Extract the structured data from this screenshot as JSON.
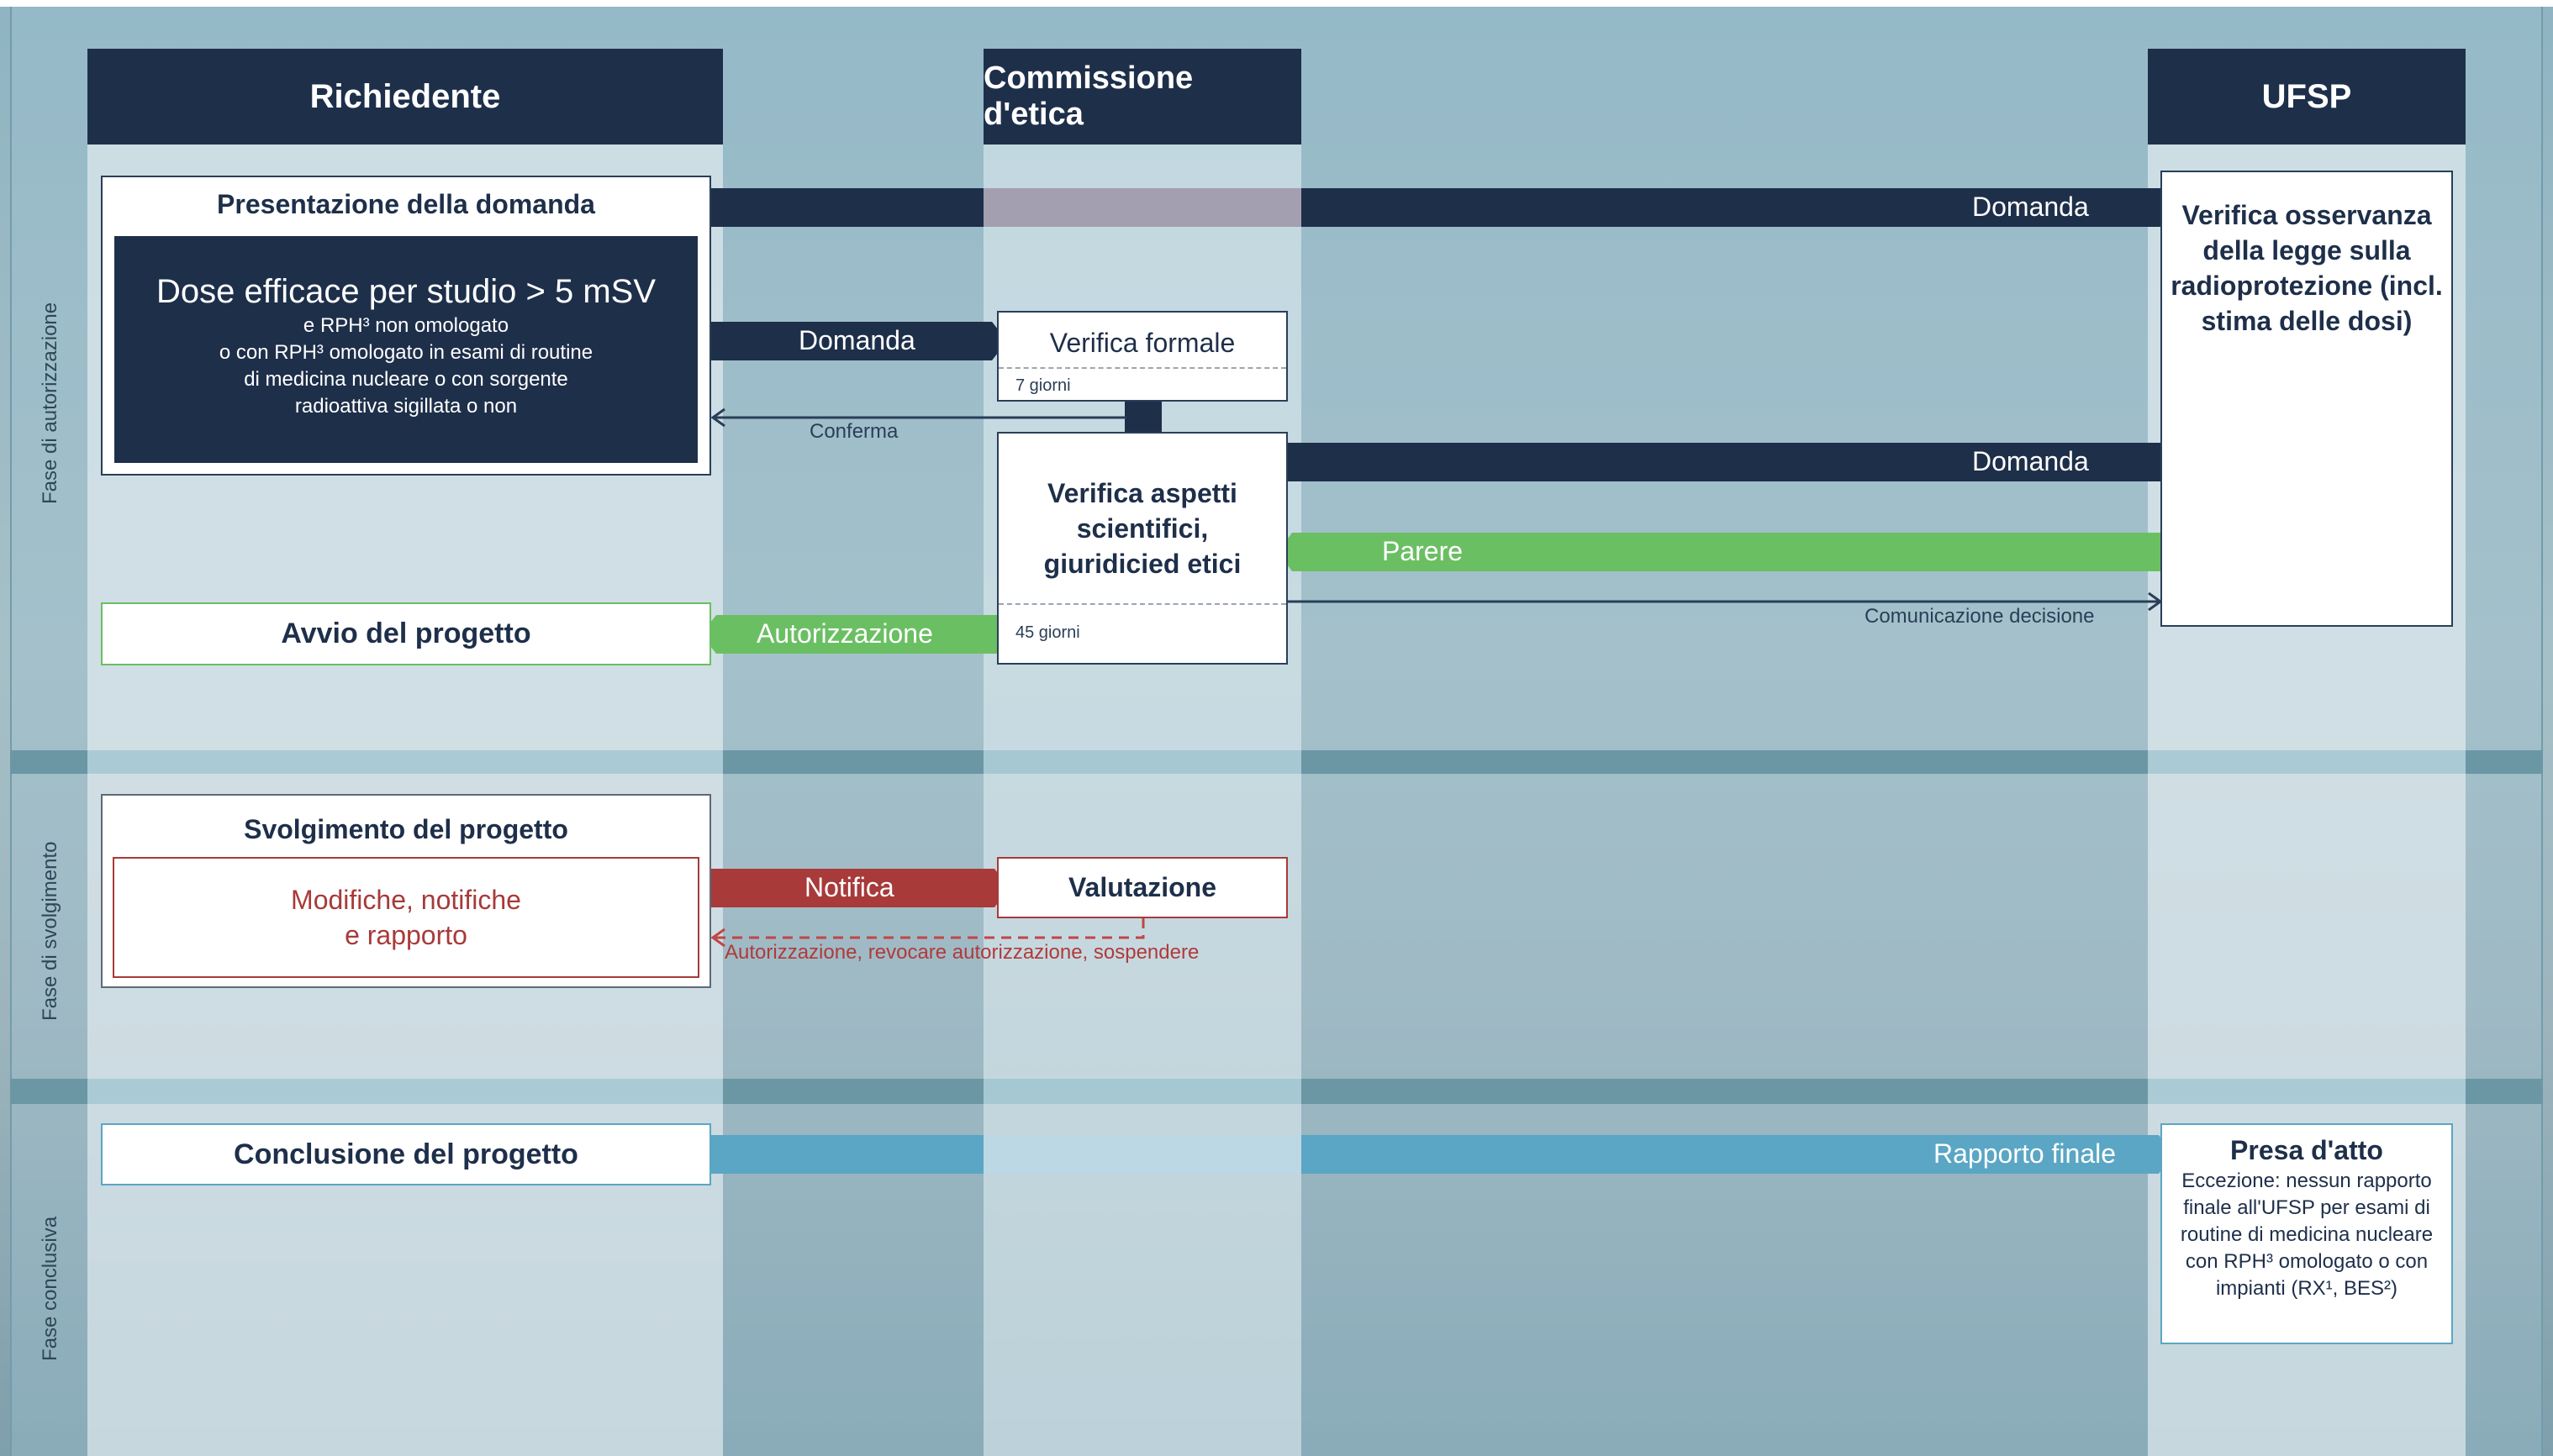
{
  "lanes": {
    "applicant": "Richiedente",
    "ethics": "Commissione d'etica",
    "ufsp": "UFSP"
  },
  "phases": {
    "authorization": "Fase di autorizzazione",
    "execution": "Fase di svolgimento",
    "conclusion": "Fase conclusiva"
  },
  "authorization": {
    "submission_title": "Presentazione della domanda",
    "dose_title": "Dose efficace per studio > 5 mSV",
    "dose_line1": "e RPH³ non omologato",
    "dose_line2": "o con RPH³ omologato in esami di routine",
    "dose_line3": "di medicina nucleare o con sorgente",
    "dose_line4": "radioattiva sigillata o non",
    "arrow_domanda_top": "Domanda",
    "arrow_domanda_ethics": "Domanda",
    "formal_check": "Verifica formale",
    "formal_days": "7 giorni",
    "confirm": "Conferma",
    "scientific_line1": "Verifica aspetti",
    "scientific_line2": "scientifici,",
    "scientific_line3": "giuridicied etici",
    "scientific_days": "45 giorni",
    "arrow_domanda_ufsp": "Domanda",
    "arrow_parere": "Parere",
    "comm_decision": "Comunicazione decisione",
    "arrow_autorizzazione": "Autorizzazione",
    "project_start": "Avvio del progetto",
    "ufsp_line1": "Verifica osservanza",
    "ufsp_line2": "della legge sulla",
    "ufsp_line3": "radioprotezione (incl.",
    "ufsp_line4": "stima delle dosi)"
  },
  "execution": {
    "title": "Svolgimento del progetto",
    "changes_line1": "Modifiche, notifiche",
    "changes_line2": "e rapporto",
    "arrow_notifica": "Notifica",
    "evaluation": "Valutazione",
    "response": "Autorizzazione, revocare autorizzazione, sospendere"
  },
  "conclusion": {
    "title": "Conclusione del progetto",
    "arrow_final": "Rapporto finale",
    "ack_title": "Presa d'atto",
    "ack_line1": "Eccezione: nessun rapporto",
    "ack_line2": "finale all'UFSP per esami di",
    "ack_line3": "routine di medicina nucleare",
    "ack_line4": "con RPH³ omologato o con",
    "ack_line5": "impianti (RX¹, BES²)"
  },
  "colors": {
    "navy": "#1e2f4a",
    "green": "#6bbf63",
    "red": "#a83a3a",
    "blue": "#5aa6c4"
  }
}
